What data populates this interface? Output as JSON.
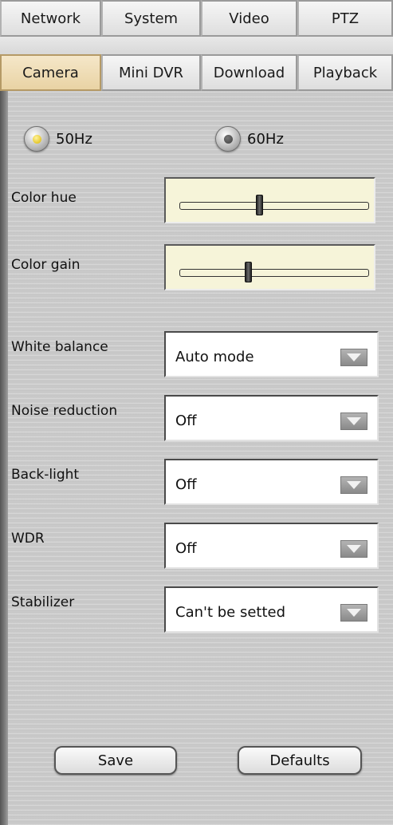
{
  "tabs_row1": [
    "Network",
    "System",
    "Video",
    "PTZ"
  ],
  "tabs_row2": [
    "Camera",
    "Mini DVR",
    "Download",
    "Playback"
  ],
  "active_tab": "Camera",
  "frequency": {
    "option_a": "50Hz",
    "option_b": "60Hz",
    "selected": "50Hz"
  },
  "color_hue": {
    "label": "Color hue",
    "level": 0.42
  },
  "color_gain": {
    "label": "Color gain",
    "level": 0.36
  },
  "white_balance": {
    "label": "White balance",
    "value": "Auto mode"
  },
  "noise_reduction": {
    "label": "Noise reduction",
    "value": "Off"
  },
  "back_light": {
    "label": "Back-light",
    "value": "Off"
  },
  "wdr": {
    "label": "WDR",
    "value": "Off"
  },
  "stabilizer": {
    "label": "Stabilizer",
    "value": "Can't be setted"
  },
  "buttons": {
    "save": "Save",
    "defaults": "Defaults"
  },
  "colors": {
    "active_tab": "#f0deb7",
    "slider_bg": "#f6f4d9",
    "radio_on": "#e8c600"
  }
}
